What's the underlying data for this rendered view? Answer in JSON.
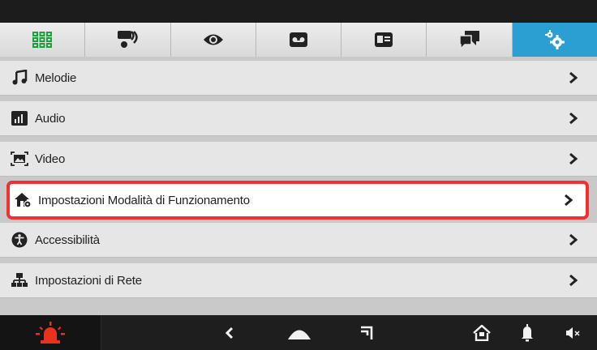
{
  "tabs": [
    {
      "icon": "grid-icon",
      "active": false
    },
    {
      "icon": "intercom-call-icon",
      "active": false
    },
    {
      "icon": "eye-icon",
      "active": false
    },
    {
      "icon": "voicemail-icon",
      "active": false
    },
    {
      "icon": "contact-card-icon",
      "active": false
    },
    {
      "icon": "chat-bubbles-icon",
      "active": false
    },
    {
      "icon": "settings-gears-icon",
      "active": true
    }
  ],
  "settings_menu": {
    "items": [
      {
        "label": "Melodie",
        "icon": "music-note-icon"
      },
      {
        "label": "Audio",
        "icon": "audio-bars-icon"
      },
      {
        "label": "Video",
        "icon": "video-image-icon"
      },
      {
        "label": "Impostazioni Modalità di Funzionamento",
        "icon": "house-gear-icon",
        "selected": true
      },
      {
        "label": "Accessibilità",
        "icon": "accessibility-icon"
      },
      {
        "label": "Impostazioni di Rete",
        "icon": "network-icon"
      }
    ]
  },
  "navbar": {
    "items": [
      "alarm-siren-icon",
      "back-icon",
      "home-dome-icon",
      "recent-icon",
      "house-icon",
      "bell-icon",
      "volume-mute-icon"
    ]
  },
  "colors": {
    "accent": "#2b9fd2",
    "selection_border": "#f23030",
    "grid_icon": "#1aa33a",
    "alarm_icon": "#e8321e"
  }
}
